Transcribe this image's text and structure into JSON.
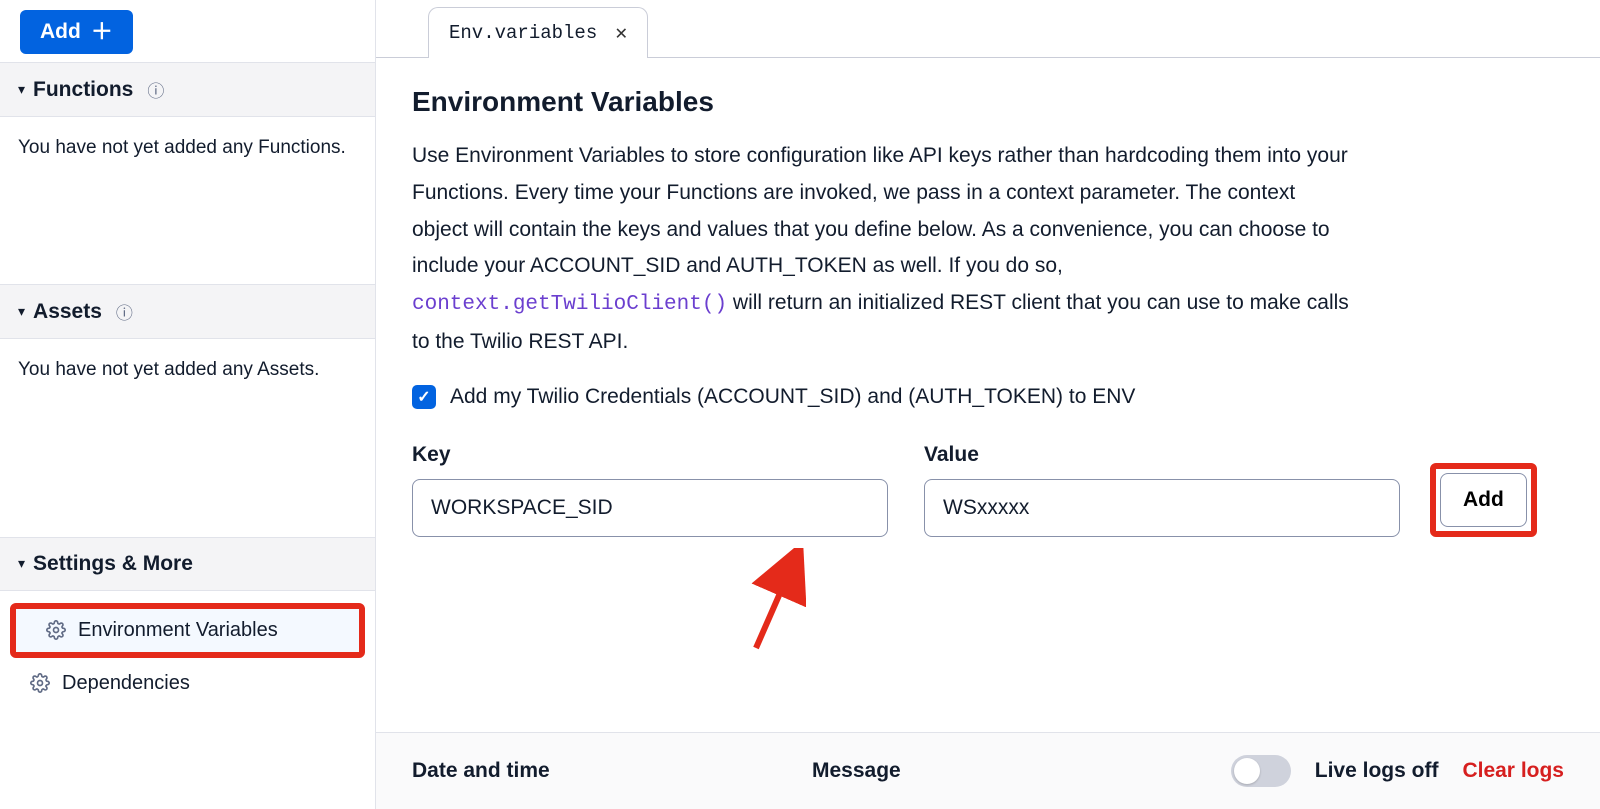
{
  "sidebar": {
    "add_button": "Add",
    "functions": {
      "title": "Functions",
      "empty": "You have not yet added any Functions."
    },
    "assets": {
      "title": "Assets",
      "empty": "You have not yet added any Assets."
    },
    "settings": {
      "title": "Settings & More",
      "items": [
        {
          "label": "Environment Variables"
        },
        {
          "label": "Dependencies"
        }
      ]
    }
  },
  "tab": {
    "label": "Env.variables"
  },
  "page": {
    "title": "Environment Variables",
    "desc_part1": "Use Environment Variables to store configuration like API keys rather than hardcoding them into your Functions. Every time your Functions are invoked, we pass in a context parameter. The context object will contain the keys and values that you define below. As a convenience, you can choose to include your ACCOUNT_SID and AUTH_TOKEN as well. If you do so, ",
    "desc_code": "context.getTwilioClient()",
    "desc_part2": " will return an initialized REST client that you can use to make calls to the Twilio REST API.",
    "checkbox_label": "Add my Twilio Credentials (ACCOUNT_SID) and (AUTH_TOKEN) to ENV",
    "checkbox_checked": true,
    "form": {
      "key_label": "Key",
      "key_value": "WORKSPACE_SID",
      "value_label": "Value",
      "value_value": "WSxxxxx",
      "add_button": "Add"
    }
  },
  "logs": {
    "col_date": "Date and time",
    "col_message": "Message",
    "toggle_label": "Live logs off",
    "clear": "Clear logs"
  }
}
